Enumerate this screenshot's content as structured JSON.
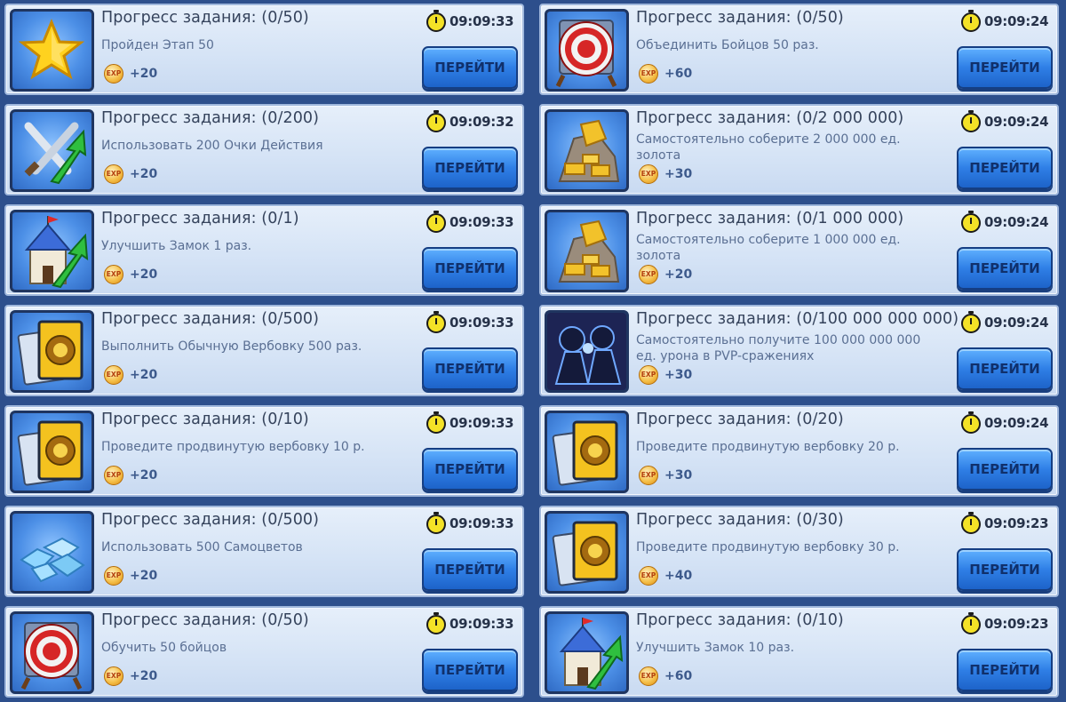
{
  "go_label": "ПЕРЕЙТИ",
  "exp_label": "EXP",
  "tasks": [
    {
      "icon": "star-icon",
      "title": "Прогресс задания: (0/50)",
      "desc": "Пройден Этап 50",
      "reward": "+20",
      "time": "09:09:33"
    },
    {
      "icon": "target-icon",
      "title": "Прогресс задания: (0/50)",
      "desc": "Объединить Бойцов 50 раз.",
      "reward": "+60",
      "time": "09:09:24"
    },
    {
      "icon": "swords-upgrade-icon",
      "title": "Прогресс задания: (0/200)",
      "desc": "Использовать 200 Очки Действия",
      "reward": "+20",
      "time": "09:09:32"
    },
    {
      "icon": "gold-pile-icon",
      "title": "Прогресс задания: (0/2 000 000)",
      "desc": "Самостоятельно соберите 2 000 000 ед. золота",
      "reward": "+30",
      "time": "09:09:24"
    },
    {
      "icon": "castle-upgrade-icon",
      "title": "Прогресс задания: (0/1)",
      "desc": "Улучшить Замок 1 раз.",
      "reward": "+20",
      "time": "09:09:33"
    },
    {
      "icon": "gold-pile-icon",
      "title": "Прогресс задания: (0/1 000 000)",
      "desc": "Самостоятельно соберите 1 000 000 ед. золота",
      "reward": "+20",
      "time": "09:09:24"
    },
    {
      "icon": "recruit-card-icon",
      "title": "Прогресс задания: (0/500)",
      "desc": "Выполнить Обычную Вербовку 500 раз.",
      "reward": "+20",
      "time": "09:09:33"
    },
    {
      "icon": "pvp-fighters-icon",
      "title": "Прогресс задания: (0/100 000 000 000)",
      "desc": "Самостоятельно получите 100 000 000 000 ед. урона в PVP-сражениях",
      "reward": "+30",
      "time": "09:09:24"
    },
    {
      "icon": "recruit-card-icon",
      "title": "Прогресс задания: (0/10)",
      "desc": "Проведите продвинутую вербовку 10 р.",
      "reward": "+20",
      "time": "09:09:33"
    },
    {
      "icon": "recruit-card-icon",
      "title": "Прогресс задания: (0/20)",
      "desc": "Проведите продвинутую вербовку 20 р.",
      "reward": "+30",
      "time": "09:09:24"
    },
    {
      "icon": "gems-icon",
      "title": "Прогресс задания: (0/500)",
      "desc": "Использовать 500 Самоцветов",
      "reward": "+20",
      "time": "09:09:33"
    },
    {
      "icon": "recruit-card-icon",
      "title": "Прогресс задания: (0/30)",
      "desc": "Проведите продвинутую вербовку 30 р.",
      "reward": "+40",
      "time": "09:09:23"
    },
    {
      "icon": "target-icon",
      "title": "Прогресс задания: (0/50)",
      "desc": "Обучить 50 бойцов",
      "reward": "+20",
      "time": "09:09:33"
    },
    {
      "icon": "castle-upgrade-icon",
      "title": "Прогресс задания: (0/10)",
      "desc": "Улучшить Замок 10 раз.",
      "reward": "+60",
      "time": "09:09:23"
    }
  ]
}
